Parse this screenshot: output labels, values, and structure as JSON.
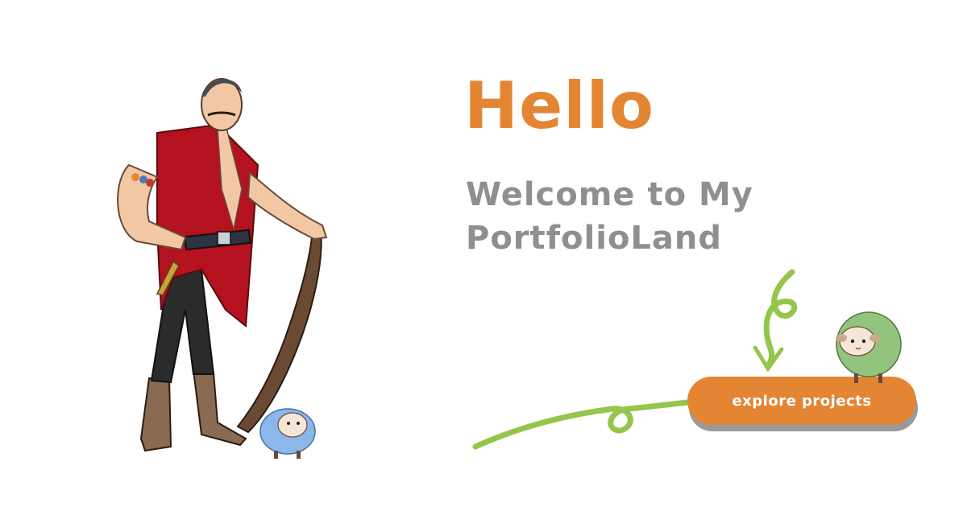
{
  "hero": {
    "title": "Hello",
    "subtitle_line1": "Welcome to My",
    "subtitle_line2": "PortfolioLand"
  },
  "cta": {
    "label": "explore projects"
  },
  "colors": {
    "accent": "#e48533",
    "subtitle": "#8f8f8f",
    "doodle_green": "#93c64a",
    "background": "#ffffff"
  },
  "icons": {
    "hero_character": "mustached-strongman-illustration",
    "blue_sheep": "blue-sheep-icon",
    "green_sheep": "green-sheep-icon",
    "arrow": "doodle-arrow-icon"
  }
}
